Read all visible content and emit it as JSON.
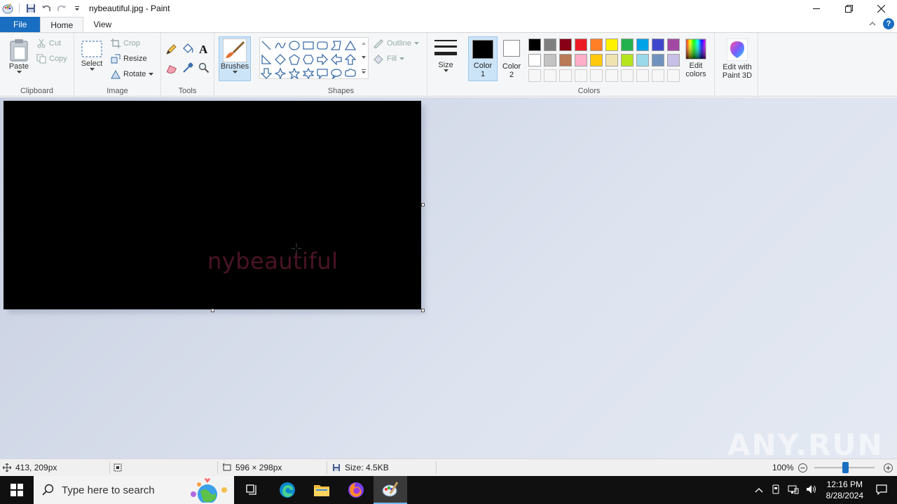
{
  "window": {
    "title": "nybeautiful.jpg - Paint"
  },
  "tabs": [
    {
      "label": "File"
    },
    {
      "label": "Home"
    },
    {
      "label": "View"
    }
  ],
  "ribbon": {
    "clipboard": {
      "label": "Clipboard",
      "paste": "Paste",
      "cut": "Cut",
      "copy": "Copy"
    },
    "image": {
      "label": "Image",
      "select": "Select",
      "crop": "Crop",
      "resize": "Resize",
      "rotate": "Rotate"
    },
    "tools": {
      "label": "Tools"
    },
    "brushes": {
      "label": "Brushes"
    },
    "shapes": {
      "label": "Shapes",
      "outline": "Outline",
      "fill": "Fill"
    },
    "size": {
      "label": "Size"
    },
    "colors": {
      "label": "Colors",
      "color1_line1": "Color",
      "color1_line2": "1",
      "color2_line1": "Color",
      "color2_line2": "2",
      "color1_value": "#000000",
      "color2_value": "#ffffff",
      "edit_line1": "Edit",
      "edit_line2": "colors",
      "palette_row1": [
        "#000000",
        "#7f7f7f",
        "#880015",
        "#ed1c24",
        "#ff7f27",
        "#fff200",
        "#22b14c",
        "#00a2e8",
        "#3f48cc",
        "#a349a4"
      ],
      "palette_row2": [
        "#ffffff",
        "#c3c3c3",
        "#b97a57",
        "#ffaec9",
        "#ffc90e",
        "#efe4b0",
        "#b5e61d",
        "#99d9ea",
        "#7092be",
        "#c8bfe7"
      ]
    },
    "paint3d": {
      "line1": "Edit with",
      "line2": "Paint 3D"
    }
  },
  "canvas": {
    "text": "nybeautiful",
    "background": "#000000",
    "text_color": "#4a1424"
  },
  "watermark": "ANY.RUN",
  "statusbar": {
    "cursor_pos": "413, 209px",
    "dimensions": "596 × 298px",
    "filesize": "Size: 4.5KB",
    "zoom": "100%",
    "zoom_value": 100
  },
  "taskbar": {
    "search_placeholder": "Type here to search",
    "time": "12:16 PM",
    "date": "8/28/2024"
  }
}
